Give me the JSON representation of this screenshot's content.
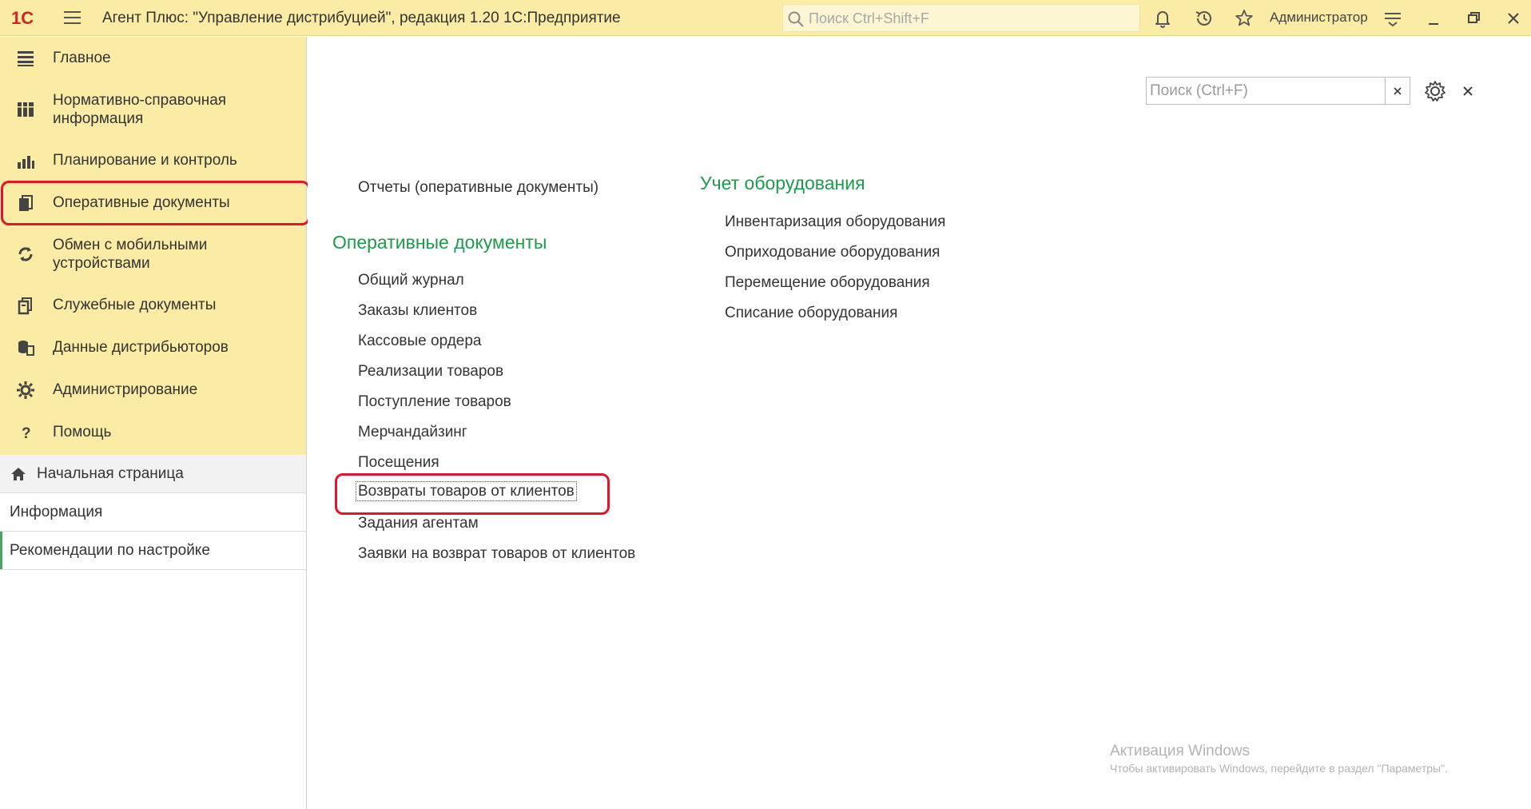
{
  "titlebar": {
    "logo_text": "1С",
    "title": "Агент Плюс: \"Управление дистрибуцией\", редакция 1.20 1С:Предприятие",
    "search_placeholder": "Поиск Ctrl+Shift+F",
    "user": "Администратор",
    "icons": [
      "bell-icon",
      "history-icon",
      "star-icon",
      "settings-lines-icon",
      "minimize-icon",
      "restore-icon",
      "close-icon"
    ]
  },
  "sidebar": {
    "sections": [
      {
        "label": "Главное",
        "icon": "menu-lines-icon"
      },
      {
        "label": "Нормативно-справочная информация",
        "icon": "catalog-icon"
      },
      {
        "label": "Планирование и контроль",
        "icon": "bar-chart-icon"
      },
      {
        "label": "Оперативные документы",
        "icon": "documents-icon",
        "active": true
      },
      {
        "label": "Обмен с мобильными устройствами",
        "icon": "sync-icon"
      },
      {
        "label": "Служебные документы",
        "icon": "service-docs-icon"
      },
      {
        "label": "Данные дистрибьюторов",
        "icon": "distributor-data-icon"
      },
      {
        "label": "Администрирование",
        "icon": "gear-icon"
      },
      {
        "label": "Помощь",
        "icon": "help-icon"
      }
    ],
    "nav": [
      {
        "label": "Начальная страница",
        "icon": "home-icon"
      },
      {
        "label": "Информация"
      },
      {
        "label": "Рекомендации по настройке",
        "selected": true
      }
    ]
  },
  "main": {
    "search_placeholder": "Поиск (Ctrl+F)",
    "reports_link": "Отчеты (оперативные документы)",
    "group1": {
      "title": "Оперативные документы",
      "items": [
        "Общий журнал",
        "Заказы клиентов",
        "Кассовые ордера",
        "Реализации товаров",
        "Поступление товаров",
        "Мерчандайзинг",
        "Посещения",
        "Возвраты товаров от клиентов",
        "Задания агентам",
        "Заявки на возврат товаров от клиентов"
      ]
    },
    "group2": {
      "title": "Учет оборудования",
      "items": [
        "Инвентаризация оборудования",
        "Оприходование оборудования",
        "Перемещение оборудования",
        "Списание оборудования"
      ]
    }
  },
  "watermark": {
    "title": "Активация Windows",
    "subtitle": "Чтобы активировать Windows, перейдите в раздел \"Параметры\"."
  },
  "colors": {
    "titlebar_bg": "#fbeca5",
    "group_title": "#1d9b4a",
    "highlight": "#e2152a",
    "selected_marker": "#4aa564"
  }
}
